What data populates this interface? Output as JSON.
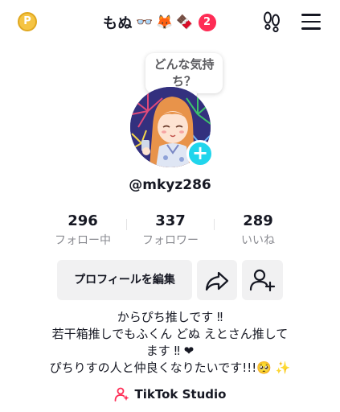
{
  "header": {
    "coin_label": "P",
    "display_name": "もぬ",
    "name_emojis": [
      "👓",
      "🦊",
      "🍫"
    ],
    "notification_count": "2"
  },
  "mood_bubble": {
    "text": "どんな気持\nち？"
  },
  "profile": {
    "username": "@mkyz286",
    "add_avatar_symbol": "+"
  },
  "stats": [
    {
      "value": "296",
      "label": "フォロー中"
    },
    {
      "value": "337",
      "label": "フォロワー"
    },
    {
      "value": "289",
      "label": "いいね"
    }
  ],
  "actions": {
    "edit_profile_label": "プロフィールを編集"
  },
  "bio": {
    "lines": [
      "からぴち推しです ‼",
      "若干箱推しでもふくん どぬ えとさん推して",
      "ます ‼ ❤",
      "ぴちりすの人と仲良くなりたいです!!!🥺 ✨"
    ]
  },
  "studio": {
    "label": "TikTok Studio"
  },
  "colors": {
    "accent_red": "#fe2c55",
    "accent_cyan": "#20d5ec",
    "button_bg": "#f1f1f2",
    "muted_text": "#8a8b91"
  },
  "icons": [
    "coin-icon",
    "footprints-icon",
    "menu-icon",
    "share-icon",
    "add-friend-icon",
    "studio-icon"
  ]
}
